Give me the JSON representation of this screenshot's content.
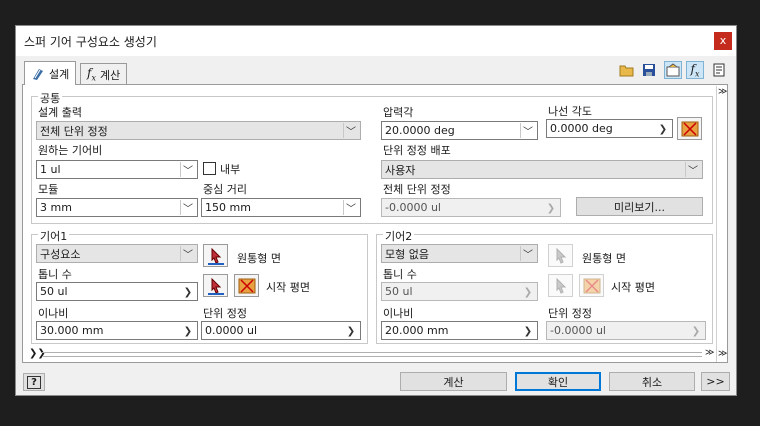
{
  "window": {
    "title": "스퍼 기어 구성요소 생성기",
    "close_label": "x"
  },
  "tabs": [
    {
      "label": "설계",
      "icon": "gear-design-icon"
    },
    {
      "label": "계산",
      "icon": "formula-icon"
    }
  ],
  "toolbar_icons": [
    "open-folder-icon",
    "save-icon",
    "expert-mode-icon",
    "formula-icon",
    "notes-icon"
  ],
  "common": {
    "group_label": "공통",
    "design_guide_label": "설계 출력",
    "design_guide_value": "전체 단위 정정",
    "pressure_angle_label": "압력각",
    "pressure_angle_value": "20.0000 deg",
    "helix_angle_label": "나선 각도",
    "helix_angle_value": "0.0000 deg",
    "desired_ratio_label": "원하는 기어비",
    "desired_ratio_value": "1 ul",
    "internal_label": "내부",
    "unit_correction_label": "단위 정정 배포",
    "unit_correction_value": "사용자",
    "module_label": "모듈",
    "module_value": "3 mm",
    "center_distance_label": "중심 거리",
    "center_distance_value": "150 mm",
    "total_correction_label": "전체 단위 정정",
    "total_correction_value": "-0.0000 ul",
    "preview_label": "미리보기..."
  },
  "gear1": {
    "group_label": "기어1",
    "type_value": "구성요소",
    "cylindrical_face_label": "원통형 면",
    "teeth_label": "톱니 수",
    "teeth_value": "50 ul",
    "start_plane_label": "시작 평면",
    "facewidth_label": "이나비",
    "facewidth_value": "30.000 mm",
    "correction_label": "단위 정정",
    "correction_value": "0.0000 ul"
  },
  "gear2": {
    "group_label": "기어2",
    "type_value": "모형 없음",
    "cylindrical_face_label": "원통형 면",
    "teeth_label": "톱니 수",
    "teeth_value": "50 ul",
    "start_plane_label": "시작 평면",
    "facewidth_label": "이나비",
    "facewidth_value": "20.000 mm",
    "correction_label": "단위 정정",
    "correction_value": "-0.0000 ul"
  },
  "footer": {
    "help_icon": "help-icon",
    "calculate_label": "계산",
    "ok_label": "확인",
    "cancel_label": "취소",
    "more_label": ">>"
  }
}
